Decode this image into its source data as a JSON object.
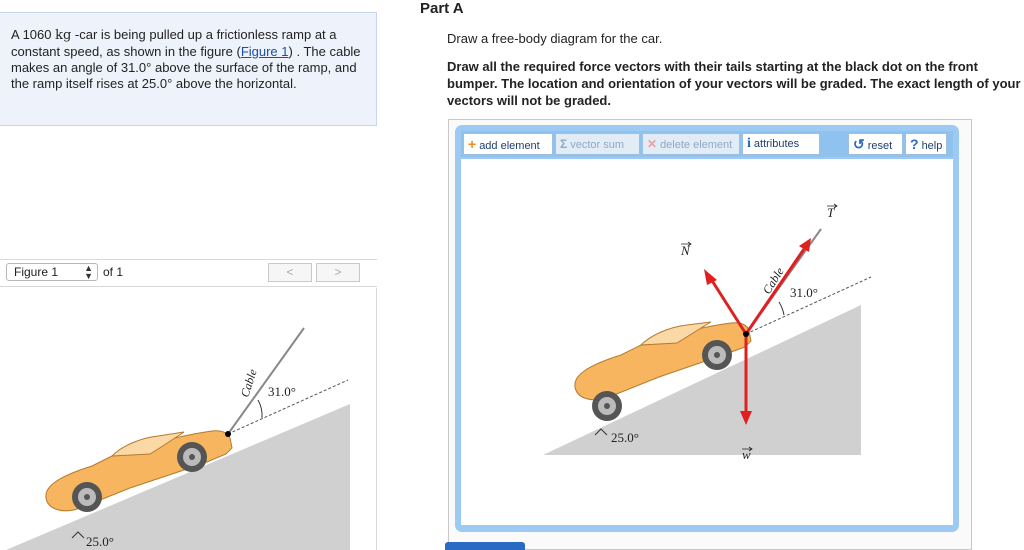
{
  "problem": {
    "text_before_mass": "A 1060 ",
    "unit": "kg",
    "text_after_mass": " -car is being pulled up a frictionless ramp at a constant speed, as shown in the figure (",
    "figure_link": "Figure 1",
    "text_end": ") . The cable makes an angle of 31.0° above the surface of the ramp, and the ramp itself rises at 25.0° above the horizontal."
  },
  "figure_nav": {
    "selected": "Figure 1",
    "of_text": "of 1",
    "prev": "<",
    "next": ">"
  },
  "figure": {
    "cable_label": "Cable",
    "cable_angle": "31.0°",
    "ramp_angle": "25.0°"
  },
  "part": {
    "title": "Part A",
    "instruction": "Draw a free-body diagram for the car.",
    "bold_instruction": "Draw all the required force vectors with their tails starting at the black dot on the front bumper. The location and orientation of your vectors will be graded. The exact length of your vectors will not be graded."
  },
  "toolbar": {
    "add_label": "add element",
    "sum_label": "vector sum",
    "delete_label": "delete element",
    "attributes_label": "attributes",
    "reset_label": "reset",
    "help_label": "help"
  },
  "diagram": {
    "cable_label": "Cable",
    "cable_angle": "31.0°",
    "ramp_angle": "25.0°",
    "normal_label": "N",
    "tension_label": "T",
    "weight_label": "w"
  },
  "colors": {
    "vector_red": "#e02020",
    "ramp_gray": "#d0d0d0",
    "car_orange": "#f6b55e",
    "toolbar_blue": "#9ccaf2"
  },
  "icons": {
    "add": "plus-icon",
    "sum": "sigma-icon",
    "delete": "x-icon",
    "attributes": "info-icon",
    "reset": "reset-icon",
    "help": "question-icon"
  }
}
